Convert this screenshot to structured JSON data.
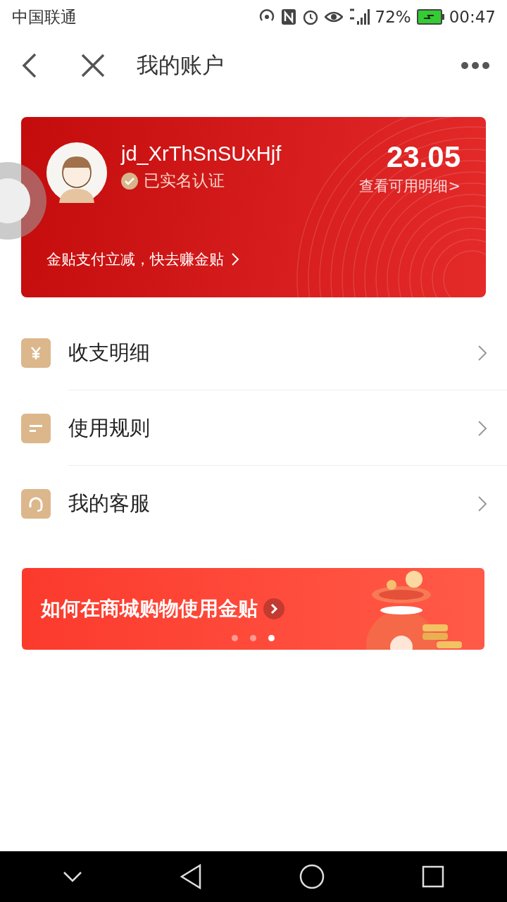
{
  "status_bar": {
    "carrier": "中国联通",
    "battery": "72%",
    "time": "00:47"
  },
  "header": {
    "title": "我的账户"
  },
  "account": {
    "username": "jd_XrThSnSUxHjf",
    "verified": true,
    "verified_label": "已实名认证",
    "balance": "23.05",
    "balance_link": "查看可用明细>",
    "promo_link": "金贴支付立减，快去赚金贴"
  },
  "menu": [
    {
      "label": "收支明细",
      "kind": "yen"
    },
    {
      "label": "使用规则",
      "kind": "rules"
    },
    {
      "label": "我的客服",
      "kind": "service"
    }
  ],
  "banner": {
    "text": "如何在商城购物使用金贴",
    "dots": [
      {
        "selected": false
      },
      {
        "selected": false
      },
      {
        "selected": true
      }
    ]
  }
}
